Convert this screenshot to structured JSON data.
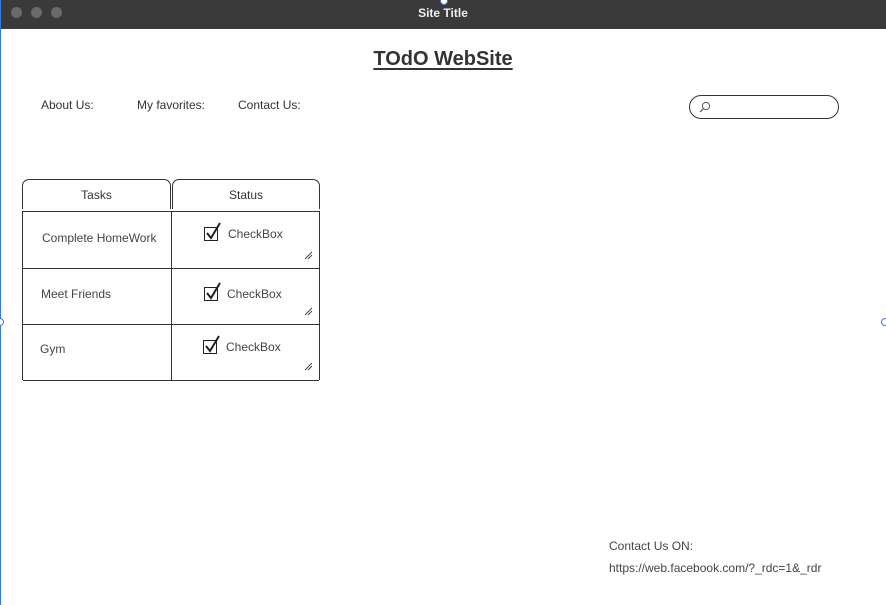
{
  "window": {
    "title": "Site Title"
  },
  "header": {
    "title": "TOdO WebSite"
  },
  "nav": [
    {
      "label": "About Us:"
    },
    {
      "label": "My favorites:"
    },
    {
      "label": "Contact Us:"
    }
  ],
  "search": {
    "placeholder": "",
    "value": ""
  },
  "table": {
    "headers": [
      "Tasks",
      "Status"
    ],
    "rows": [
      {
        "task": "Complete HomeWork",
        "status": "CheckBox",
        "checked": true
      },
      {
        "task": "Meet Friends",
        "status": "CheckBox",
        "checked": true
      },
      {
        "task": "Gym",
        "status": "CheckBox",
        "checked": true
      }
    ]
  },
  "footer": {
    "label": "Contact Us ON:",
    "link": "https://web.facebook.com/?_rdc=1&_rdr"
  },
  "colors": {
    "titlebar": "#3a3a3a",
    "border": "#333333",
    "selection": "#3a7bd5"
  }
}
